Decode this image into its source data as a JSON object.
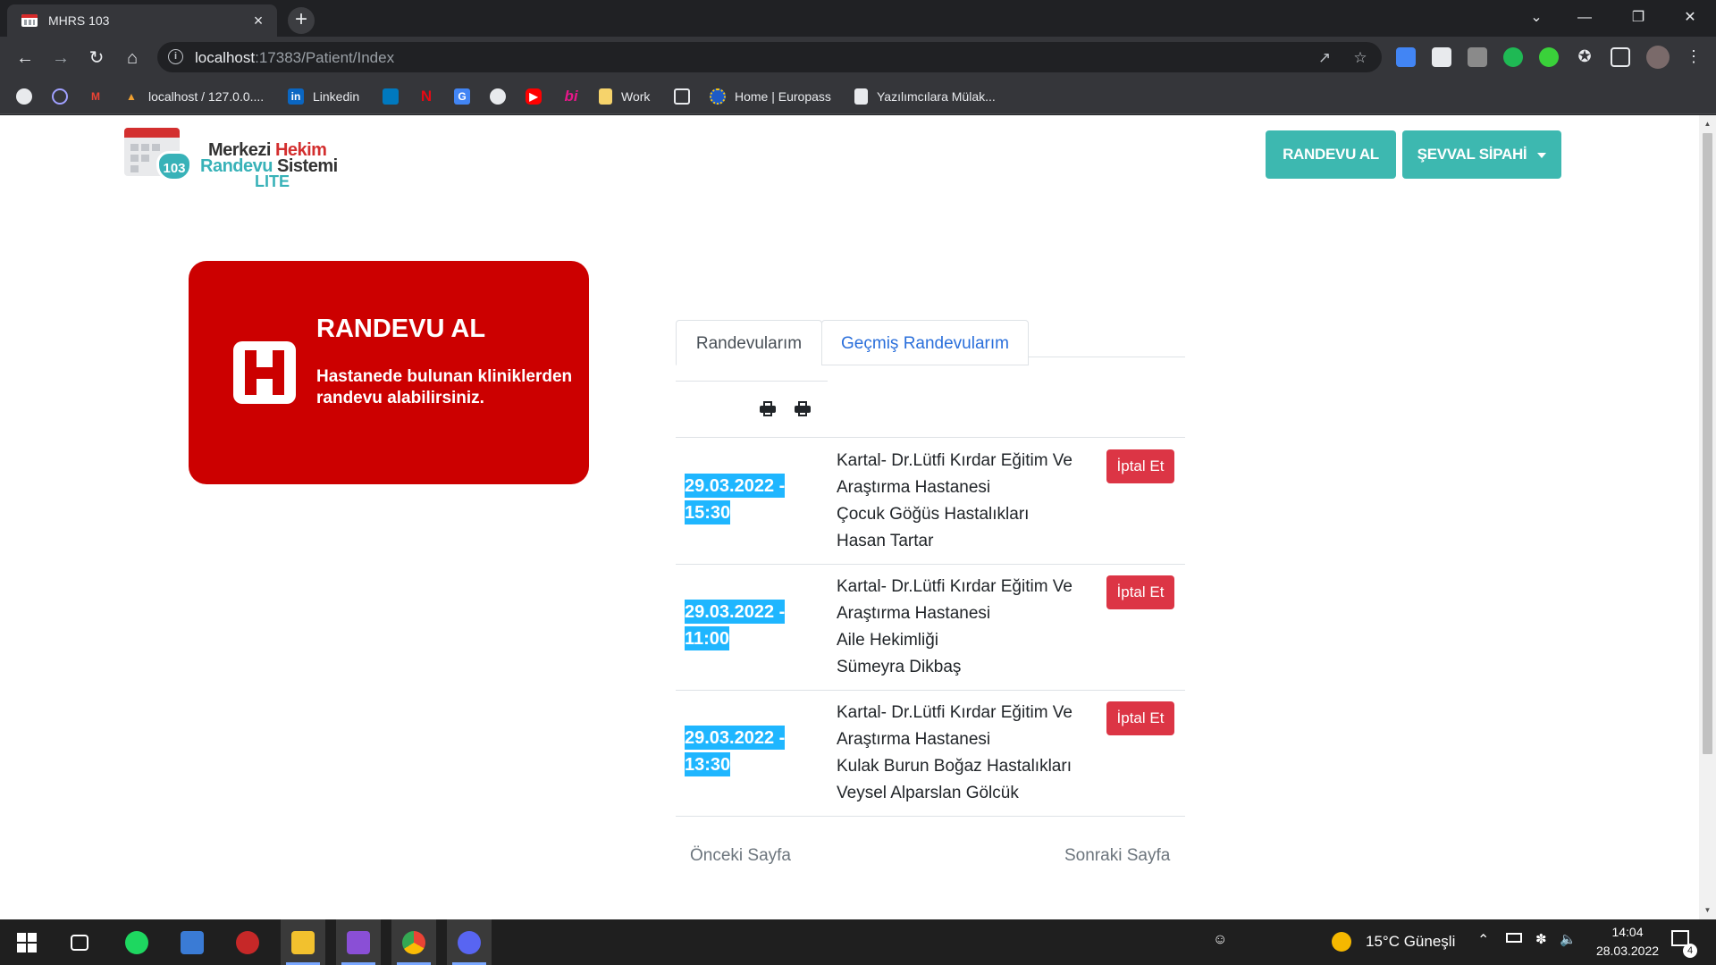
{
  "browser": {
    "tab_title": "MHRS 103",
    "tab_close": "×",
    "new_tab": "+",
    "url_host": "localhost",
    "url_rest": ":17383/Patient/Index",
    "window_controls": [
      "⌄",
      "—",
      "❐",
      "✕"
    ]
  },
  "bookmarks": [
    {
      "label": "",
      "icon": "chrome-icon",
      "color": "#e8eaed"
    },
    {
      "label": "",
      "icon": "circle-icon",
      "color": "#a0a0ff"
    },
    {
      "label": "",
      "icon": "gmail-icon",
      "color": "#ea4335"
    },
    {
      "label": "localhost / 127.0.0....",
      "icon": "phpmyadmin-icon",
      "color": "#f0a030"
    },
    {
      "label": "Linkedin",
      "icon": "linkedin-icon",
      "color": "#0a66c2"
    },
    {
      "label": "",
      "icon": "trello-icon",
      "color": "#0079bf"
    },
    {
      "label": "",
      "icon": "netflix-icon",
      "color": "#e50914"
    },
    {
      "label": "",
      "icon": "translate-icon",
      "color": "#4285f4"
    },
    {
      "label": "",
      "icon": "github-icon",
      "color": "#e8eaed"
    },
    {
      "label": "",
      "icon": "youtube-icon",
      "color": "#ff0000"
    },
    {
      "label": "",
      "icon": "bi-icon",
      "color": "#e8178a"
    },
    {
      "label": "Work",
      "icon": "folder-icon",
      "color": "#f6d36b"
    },
    {
      "label": "",
      "icon": "codepen-icon",
      "color": "#e8eaed"
    },
    {
      "label": "Home | Europass",
      "icon": "europass-icon",
      "color": "#1e5bc6"
    },
    {
      "label": "Yazılımcılara Mülak...",
      "icon": "doc-icon",
      "color": "#e8eaed"
    }
  ],
  "header": {
    "logo_line1_a": "Merkezi",
    "logo_line1_b": "Hekim",
    "logo_line2_a": "Randevu",
    "logo_line2_b": "Sistemi",
    "logo_line3": "LITE",
    "logo_badge": "103",
    "appointment_button": "RANDEVU AL",
    "user_button": "ŞEVVAL SİPAHİ"
  },
  "promo_card": {
    "title": "RANDEVU AL",
    "description": "Hastanede bulunan kliniklerden randevu alabilirsiniz."
  },
  "tabs": {
    "active": "Randevularım",
    "other": "Geçmiş Randevularım"
  },
  "appointments": [
    {
      "date": "29.03.2022 - 15:30",
      "hospital_line1": "Kartal- Dr.Lütfi Kırdar Eğitim Ve",
      "hospital_line2": "Araştırma Hastanesi",
      "clinic": "Çocuk Göğüs Hastalıkları",
      "doctor": "Hasan Tartar",
      "cancel_label": "İptal Et"
    },
    {
      "date": "29.03.2022 - 11:00",
      "hospital_line1": "Kartal- Dr.Lütfi Kırdar Eğitim Ve",
      "hospital_line2": "Araştırma Hastanesi",
      "clinic": "Aile Hekimliği",
      "doctor": "Sümeyra Dikbaş",
      "cancel_label": "İptal Et"
    },
    {
      "date": "29.03.2022 - 13:30",
      "hospital_line1": "Kartal- Dr.Lütfi Kırdar Eğitim Ve",
      "hospital_line2": "Araştırma Hastanesi",
      "clinic": "Kulak Burun Boğaz Hastalıkları",
      "doctor": "Veysel Alparslan Gölcük",
      "cancel_label": "İptal Et"
    }
  ],
  "pager": {
    "prev": "Önceki Sayfa",
    "next": "Sonraki Sayfa"
  },
  "taskbar": {
    "weather": "15°C Güneşli",
    "time": "14:04",
    "date": "28.03.2022",
    "notification_count": "4"
  },
  "colors": {
    "brand_red": "#cc0000",
    "teal": "#3db8b0",
    "date_badge": "#1fb6ff",
    "cancel_red": "#dc3545",
    "link_blue": "#2a6fdb"
  }
}
